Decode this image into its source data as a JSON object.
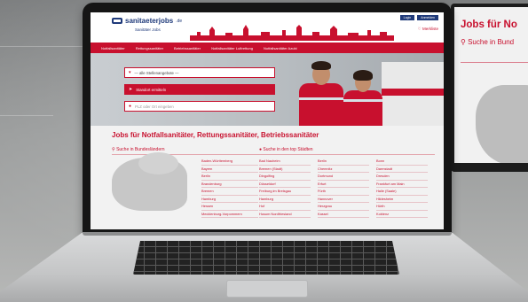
{
  "site": {
    "logo_text": "sanitaeterjobs",
    "logo_tld": ".de",
    "logo_sub": "Sanitäter Jobs",
    "login_label": "Login",
    "register_label": "Anmelden",
    "merkliste_label": "Merkliste"
  },
  "nav": {
    "items": [
      "Notfallsanitäter",
      "Rettungssanitäter",
      "Betriebssanitäter",
      "Notfallsanitäter Luftrettung",
      "Notfallsanitäter Azubi"
    ]
  },
  "hero": {
    "select_value": "— alle Stellenangebote —",
    "location_button": "Standort ermitteln",
    "plz_placeholder": "PLZ oder Ort eingeben"
  },
  "content": {
    "title": "Jobs für Notfallsanitäter, Rettungssanitäter, Betriebssanitäter",
    "states_heading": "Suche in Bundesländern",
    "cities_heading": "Suche in den top Städten",
    "states": [
      "Baden-Württemberg",
      "Bayern",
      "Berlin",
      "Brandenburg",
      "Bremen",
      "Hamburg",
      "Hessen",
      "Mecklenburg-Vorpommern"
    ],
    "cities": [
      [
        "Bad Nauheim",
        "Bremen (Stadt)",
        "Dingolfing",
        "Düsseldorf",
        "Freiburg im Breisgau",
        "Hamburg",
        "Hof",
        "Husum Nordfriesland"
      ],
      [
        "Berlin",
        "Chemnitz",
        "Dortmund",
        "Erfurt",
        "Fürth",
        "Hannover",
        "Herzgrau",
        "Kassel"
      ],
      [
        "Bonn",
        "Darmstadt",
        "Dresden",
        "Frankfurt am Main",
        "Halle (Saale)",
        "Hildesheim",
        "Hürth",
        "Koblenz"
      ]
    ]
  },
  "monitor": {
    "title": "Jobs für No",
    "search": "Suche in Bund"
  },
  "colors": {
    "brand_red": "#c8102e",
    "brand_blue": "#1f3a7a"
  }
}
